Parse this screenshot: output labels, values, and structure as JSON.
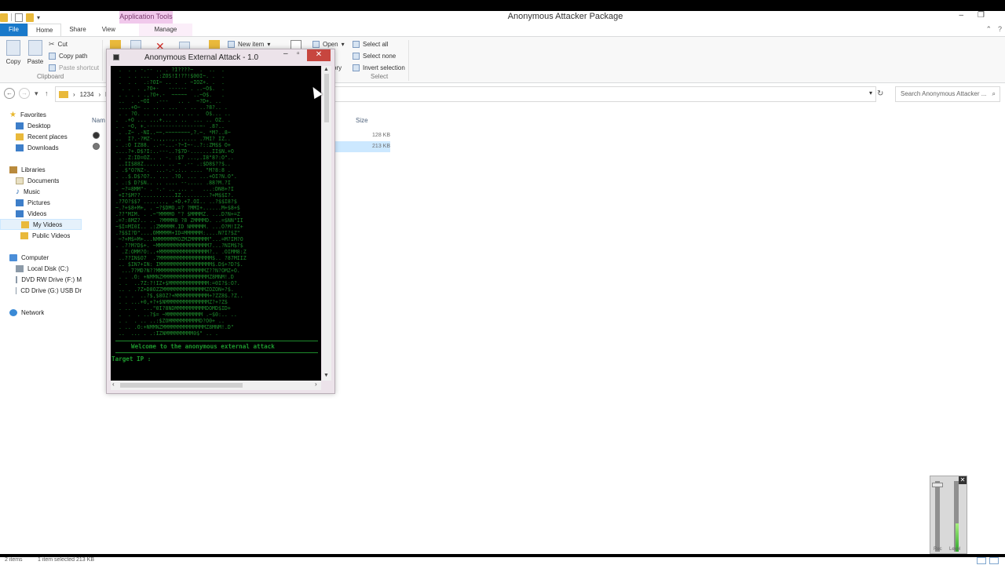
{
  "window": {
    "title": "Anonymous Attacker Package",
    "context_tab": "Application Tools",
    "controls": [
      "–",
      "❐"
    ]
  },
  "ribbon": {
    "tabs": [
      "File",
      "Home",
      "Share",
      "View",
      "Manage"
    ],
    "clipboard": {
      "copy": "Copy",
      "paste": "Paste",
      "cut": "Cut",
      "copy_path": "Copy path",
      "paste_shortcut": "Paste shortcut",
      "group": "Clipboard"
    },
    "new_item": "New item",
    "open": "Open",
    "history_partial": "ory",
    "select": {
      "select_all": "Select all",
      "select_none": "Select none",
      "invert": "Invert selection",
      "group": "Select"
    }
  },
  "address": {
    "path_segment": "1234",
    "path_partial": "b",
    "path_end_partial": "e",
    "search_placeholder": "Search Anonymous Attacker ..."
  },
  "nav": {
    "favorites": "Favorites",
    "desktop": "Desktop",
    "recent": "Recent places",
    "downloads": "Downloads",
    "libraries": "Libraries",
    "documents": "Documents",
    "music": "Music",
    "pictures": "Pictures",
    "videos": "Videos",
    "my_videos": "My Videos",
    "public_videos": "Public Videos",
    "computer": "Computer",
    "local_disk": "Local Disk (C:)",
    "dvd": "DVD RW Drive (F:) M",
    "cd": "CD Drive (G:) USB Dr",
    "network": "Network"
  },
  "files": {
    "col_name_partial": "Nam",
    "col_size": "Size",
    "rows": [
      {
        "name_partial": "A",
        "size": "128 KB"
      },
      {
        "name_partial": "A",
        "size": "213 KB"
      }
    ]
  },
  "status": {
    "items": "2 items",
    "selected": "1 item selected  213 KB"
  },
  "console": {
    "title": "Anonymous External Attack - 1.0",
    "welcome": "Welcome to the anonymous external attack",
    "prompt": "Target IP :"
  },
  "mixer": {
    "labels": [
      "Rec",
      "Level"
    ]
  }
}
